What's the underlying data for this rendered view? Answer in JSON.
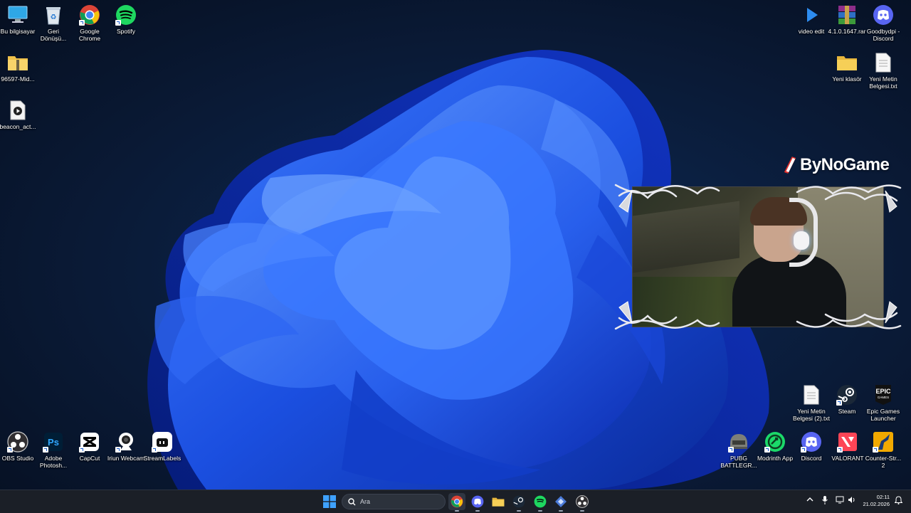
{
  "desktop_icons": {
    "bu_bilgisayar": "Bu bilgisayar",
    "geri_donusum": "Geri Dönüşü...",
    "google_chrome": "Google Chrome",
    "spotify": "Spotify",
    "folder_96597": "96597-Mid...",
    "beacon": "beacon_act...",
    "video_edit": "video edit",
    "rar": "4.1.0.1647.rar",
    "goodbydpi": "Goodbydpi - Discord",
    "yeni_klasor": "Yeni klasör",
    "yeni_metin": "Yeni Metin Belgesi.txt",
    "yeni_metin_2": "Yeni Metin Belgesi (2).txt",
    "steam": "Steam",
    "epic": "Epic Games Launcher",
    "obs": "OBS Studio",
    "photoshop": "Adobe Photosh...",
    "capcut": "CapCut",
    "iriun": "Iriun Webcam",
    "streamlabels": "StreamLabels",
    "pubg": "PUBG BATTLEGR...",
    "modrinth": "Modrinth App",
    "discord": "Discord",
    "valorant": "VALORANT",
    "counter_strike": "Counter-Str... 2"
  },
  "overlay": {
    "brand": "ByNoGame"
  },
  "taskbar": {
    "search_placeholder": "Ara",
    "clock_time": "02:11",
    "clock_date": "21.02.2026"
  },
  "colors": {
    "accent": "#1a5fd0",
    "taskbar_bg": "#1c2028",
    "wallpaper_base": "#071326"
  }
}
